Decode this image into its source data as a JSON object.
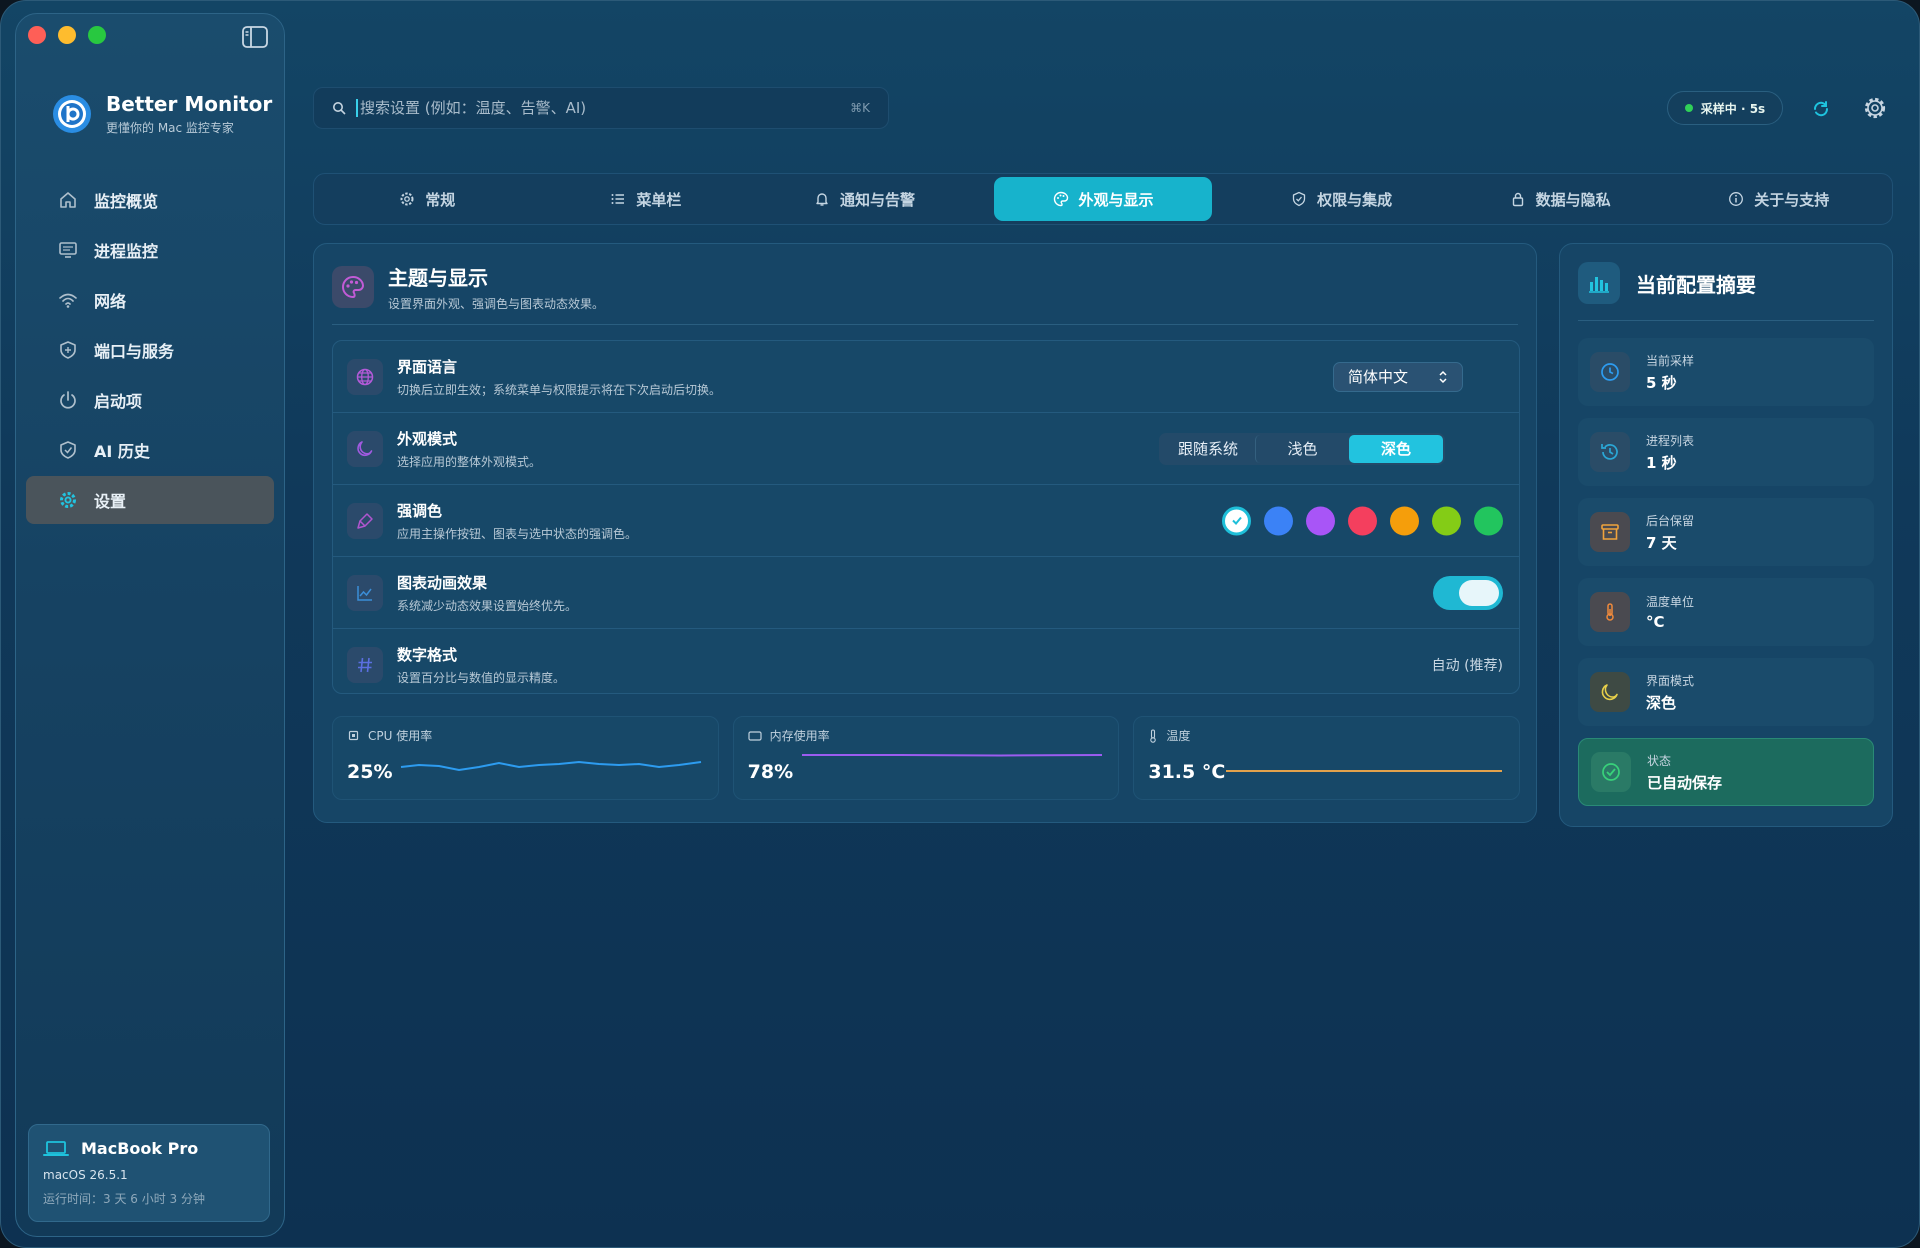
{
  "app": {
    "name": "Better Monitor",
    "tagline": "更懂你的 Mac 监控专家"
  },
  "sidebar": {
    "items": [
      {
        "label": "监控概览",
        "icon": "home-icon"
      },
      {
        "label": "进程监控",
        "icon": "monitor-icon"
      },
      {
        "label": "网络",
        "icon": "wifi-icon"
      },
      {
        "label": "端口与服务",
        "icon": "shield-icon"
      },
      {
        "label": "启动项",
        "icon": "power-icon"
      },
      {
        "label": "AI 历史",
        "icon": "shield-check-icon"
      },
      {
        "label": "设置",
        "icon": "gear-icon",
        "active": true
      }
    ],
    "device": {
      "name": "MacBook Pro",
      "os": "macOS 26.5.1",
      "uptime": "运行时间：3 天 6 小时 3 分钟"
    }
  },
  "header": {
    "search_placeholder": "搜索设置 (例如：温度、告警、AI)",
    "search_shortcut": "⌘K",
    "sampling_status": "采样中 · 5s"
  },
  "tabs": [
    {
      "label": "常规",
      "icon": "gear-icon"
    },
    {
      "label": "菜单栏",
      "icon": "list-icon"
    },
    {
      "label": "通知与告警",
      "icon": "bell-icon"
    },
    {
      "label": "外观与显示",
      "icon": "palette-icon",
      "active": true
    },
    {
      "label": "权限与集成",
      "icon": "shield-check-icon"
    },
    {
      "label": "数据与隐私",
      "icon": "lock-icon"
    },
    {
      "label": "关于与支持",
      "icon": "info-icon"
    }
  ],
  "theme_section": {
    "title": "主题与显示",
    "subtitle": "设置界面外观、强调色与图表动态效果。",
    "rows": {
      "language": {
        "title": "界面语言",
        "desc": "切换后立即生效；系统菜单与权限提示将在下次启动后切换。",
        "value": "简体中文"
      },
      "appearance": {
        "title": "外观模式",
        "desc": "选择应用的整体外观模式。",
        "options": [
          "跟随系统",
          "浅色",
          "深色"
        ],
        "selected": "深色"
      },
      "accent": {
        "title": "强调色",
        "desc": "应用主操作按钮、图表与选中状态的强调色。",
        "colors": [
          "#1ebfd9",
          "#3b82f6",
          "#a855f7",
          "#f43f5e",
          "#f59e0b",
          "#84cc16",
          "#22c55e"
        ],
        "selected_index": 0
      },
      "animation": {
        "title": "图表动画效果",
        "desc": "系统减少动态效果设置始终优先。",
        "enabled": true
      },
      "number_format": {
        "title": "数字格式",
        "desc": "设置百分比与数值的显示精度。",
        "value": "自动 (推荐)"
      }
    },
    "metrics": [
      {
        "label": "CPU 使用率",
        "value": "25%",
        "color": "#2d9cf0"
      },
      {
        "label": "内存使用率",
        "value": "78%",
        "color": "#9b5cf0"
      },
      {
        "label": "温度",
        "value": "31.5 °C",
        "color": "#e3a24c"
      }
    ]
  },
  "summary": {
    "title": "当前配置摘要",
    "items": [
      {
        "label": "当前采样",
        "value": "5 秒",
        "icon": "clock-icon"
      },
      {
        "label": "进程列表",
        "value": "1 秒",
        "icon": "history-icon"
      },
      {
        "label": "后台保留",
        "value": "7 天",
        "icon": "archive-icon"
      },
      {
        "label": "温度单位",
        "value": "°C",
        "icon": "thermometer-icon"
      },
      {
        "label": "界面模式",
        "value": "深色",
        "icon": "moon-icon"
      },
      {
        "label": "状态",
        "value": "已自动保存",
        "icon": "check-circle-icon"
      }
    ]
  }
}
